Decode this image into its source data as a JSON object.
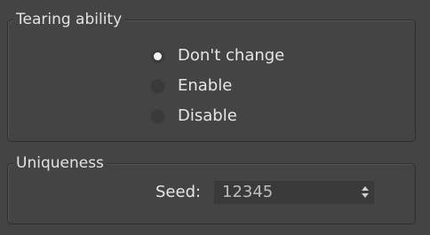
{
  "colors": {
    "background": "#444444",
    "group_border": "#2e2e2e",
    "text": "#e6e6e6",
    "field_background": "#3a3a3a",
    "radio_checked_dot": "#f2f2f2"
  },
  "tearing_ability": {
    "title": "Tearing ability",
    "options": [
      {
        "label": "Don't change",
        "checked": true
      },
      {
        "label": "Enable",
        "checked": false
      },
      {
        "label": "Disable",
        "checked": false
      }
    ]
  },
  "uniqueness": {
    "title": "Uniqueness",
    "seed_label": "Seed:",
    "seed_value": "12345",
    "spinner_icon": "spinner-up-down-icon"
  }
}
